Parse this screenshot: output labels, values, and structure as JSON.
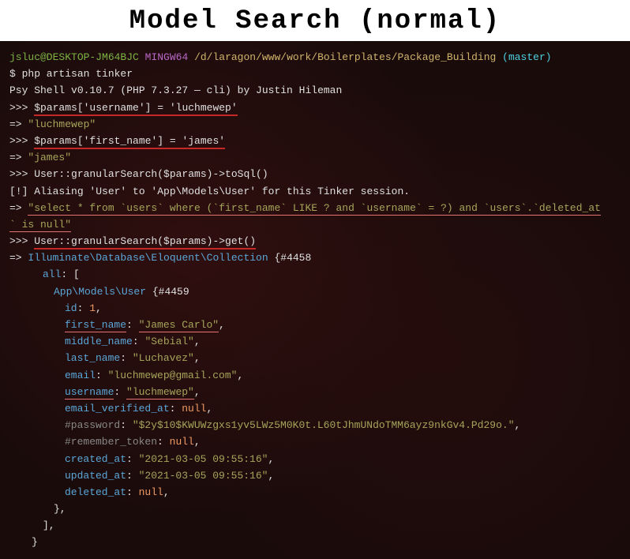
{
  "title": "Model Search (normal)",
  "prompt": {
    "user": "jsluc@DESKTOP-JM64BJC",
    "env": "MINGW64",
    "path": "/d/laragon/www/work/Boilerplates/Package_Building",
    "branch": "(master)"
  },
  "cmd_tinker": "$ php artisan tinker",
  "psy_shell": "Psy Shell v0.10.7 (PHP 7.3.27 — cli) by Justin Hileman",
  "input1": "$params['username'] = 'luchmewep'",
  "out1_arrow": "=> ",
  "out1_val": "\"luchmewep\"",
  "input2": "$params['first_name'] = 'james'",
  "out2_val": "\"james\"",
  "input3": ">>> User::granularSearch($params)->toSql()",
  "alias": "[!] Aliasing 'User' to 'App\\Models\\User' for this Tinker session.",
  "sql_line1": "\"select * from `users` where (`first_name` LIKE ? and `username` = ?) and `users`.`deleted_at",
  "sql_line2": "` is null\"",
  "input4": "User::granularSearch($params)->get()",
  "collection_class": "Illuminate\\Database\\Eloquent\\Collection",
  "collection_ref": "{#4458",
  "all_open": "all: [",
  "model_class": "App\\Models\\User",
  "model_ref": "{#4459",
  "fields": {
    "id_key": "id",
    "id_val": "1",
    "first_name_key": "first_name",
    "first_name_val": "\"James Carlo\"",
    "middle_name_key": "middle_name",
    "middle_name_val": "\"Sebial\"",
    "last_name_key": "last_name",
    "last_name_val": "\"Luchavez\"",
    "email_key": "email",
    "email_val": "\"luchmewep@gmail.com\"",
    "username_key": "username",
    "username_val": "\"luchmewep\"",
    "email_verified_at_key": "email_verified_at",
    "email_verified_at_val": "null",
    "password_key": "#password",
    "password_val": "\"$2y$10$KWUWzgxs1yv5LWz5M0K0t.L60tJhmUNdoTMM6ayz9nkGv4.Pd29o.\"",
    "remember_token_key": "#remember_token",
    "remember_token_val": "null",
    "created_at_key": "created_at",
    "created_at_val": "\"2021-03-05 09:55:16\"",
    "updated_at_key": "updated_at",
    "updated_at_val": "\"2021-03-05 09:55:16\"",
    "deleted_at_key": "deleted_at",
    "deleted_at_val": "null"
  },
  "close_brace1": "},",
  "close_bracket": "],",
  "close_brace2": "}",
  "prompt_marker": ">>> ",
  "arrow": "=> "
}
